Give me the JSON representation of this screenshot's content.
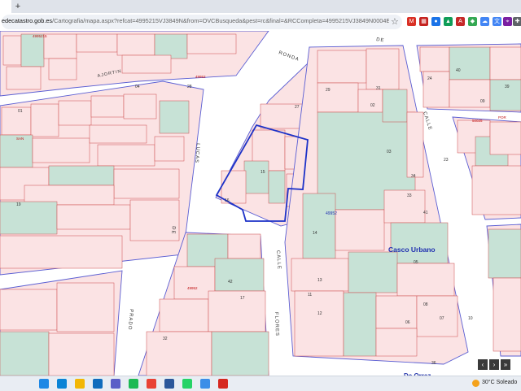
{
  "browser": {
    "url_host": "edecatastro.gob.es",
    "url_path": "/Cartografia/mapa.aspx?refcat=4995215VJ3849N&from=OVCBusqueda&pest=rc&final=&RCCompleta=4995215VJ3849N0004EU&ZV=NO&ZR=NO&a...",
    "new_tab": "+",
    "star": "☆",
    "extensions": [
      {
        "name": "gmail-icon",
        "glyph": "M",
        "color": "#d93025"
      },
      {
        "name": "calendar-icon",
        "glyph": "▦",
        "color": "#c5221f"
      },
      {
        "name": "chrome-icon",
        "glyph": "●",
        "color": "#1a73e8"
      },
      {
        "name": "drive-icon",
        "glyph": "▲",
        "color": "#0f9d58"
      },
      {
        "name": "pdf-icon",
        "glyph": "A",
        "color": "#c62828"
      },
      {
        "name": "maps-icon",
        "glyph": "◆",
        "color": "#34a853"
      },
      {
        "name": "cloud-icon",
        "glyph": "☁",
        "color": "#4285f4"
      },
      {
        "name": "translate-icon",
        "glyph": "文",
        "color": "#4285f4"
      },
      {
        "name": "pin-icon",
        "glyph": "⌖",
        "color": "#7b1fa2"
      },
      {
        "name": "extension-icon",
        "glyph": "✚",
        "color": "#5f6368"
      }
    ],
    "corner_badge": "ORGALIT"
  },
  "map": {
    "colors": {
      "parcel": "#fbe3e4",
      "parcel_stroke": "#cc4a4a",
      "patio": "#c7e2d6",
      "block_stroke": "#5a5ed3",
      "selection": "#1d32c8",
      "label_block": "#1f2fb0",
      "label_street": "#333333",
      "label_parcel": "#333333",
      "label_red": "#c01010"
    },
    "streets": [
      {
        "text": "RONDA",
        "name": "street-ronda"
      },
      {
        "text": "DE",
        "name": "street-de"
      },
      {
        "text": "AJORTIN",
        "name": "street-ajortin"
      },
      {
        "text": "CALLE",
        "name": "street-calle-right"
      },
      {
        "text": "CALLE",
        "name": "street-calle-center"
      },
      {
        "text": "FLORES",
        "name": "street-flores"
      },
      {
        "text": "LUCAS",
        "name": "street-lucas"
      },
      {
        "text": "DE",
        "name": "street-de-left"
      },
      {
        "text": "PRADO",
        "name": "street-prado"
      }
    ],
    "labels": {
      "casco_urbano": "Casco Urbano",
      "block_code": "49952",
      "bottom_street": "De Orraz"
    },
    "parcel_numbers": [
      "01",
      "02",
      "03",
      "04",
      "05",
      "06",
      "07",
      "08",
      "09",
      "10",
      "11",
      "12",
      "13",
      "14",
      "15",
      "16",
      "17",
      "19",
      "23",
      "24",
      "27",
      "28",
      "29",
      "31",
      "32",
      "33",
      "34",
      "36",
      "39",
      "40",
      "41",
      "42"
    ],
    "red_codes": [
      "4995215",
      "49952",
      "50025",
      "POR",
      "SAN",
      "49952"
    ]
  },
  "map_nav": {
    "left": "‹",
    "right": "›",
    "next": "»"
  },
  "taskbar": {
    "apps": [
      {
        "name": "windows-start-icon",
        "color": "#1e88e5"
      },
      {
        "name": "edge-icon",
        "color": "#0a84d6"
      },
      {
        "name": "file-explorer-icon",
        "color": "#f2b705"
      },
      {
        "name": "outlook-icon",
        "color": "#0f6cbd"
      },
      {
        "name": "teams-icon",
        "color": "#5b5fc7"
      },
      {
        "name": "spotify-icon",
        "color": "#1db954"
      },
      {
        "name": "chrome-icon",
        "color": "#e94235"
      },
      {
        "name": "word-icon",
        "color": "#2b579a"
      },
      {
        "name": "whatsapp-icon",
        "color": "#25d366"
      },
      {
        "name": "chat-icon",
        "color": "#3c8ee8"
      },
      {
        "name": "acrobat-icon",
        "color": "#d6281f"
      }
    ],
    "weather": "30°C  Soleado"
  }
}
